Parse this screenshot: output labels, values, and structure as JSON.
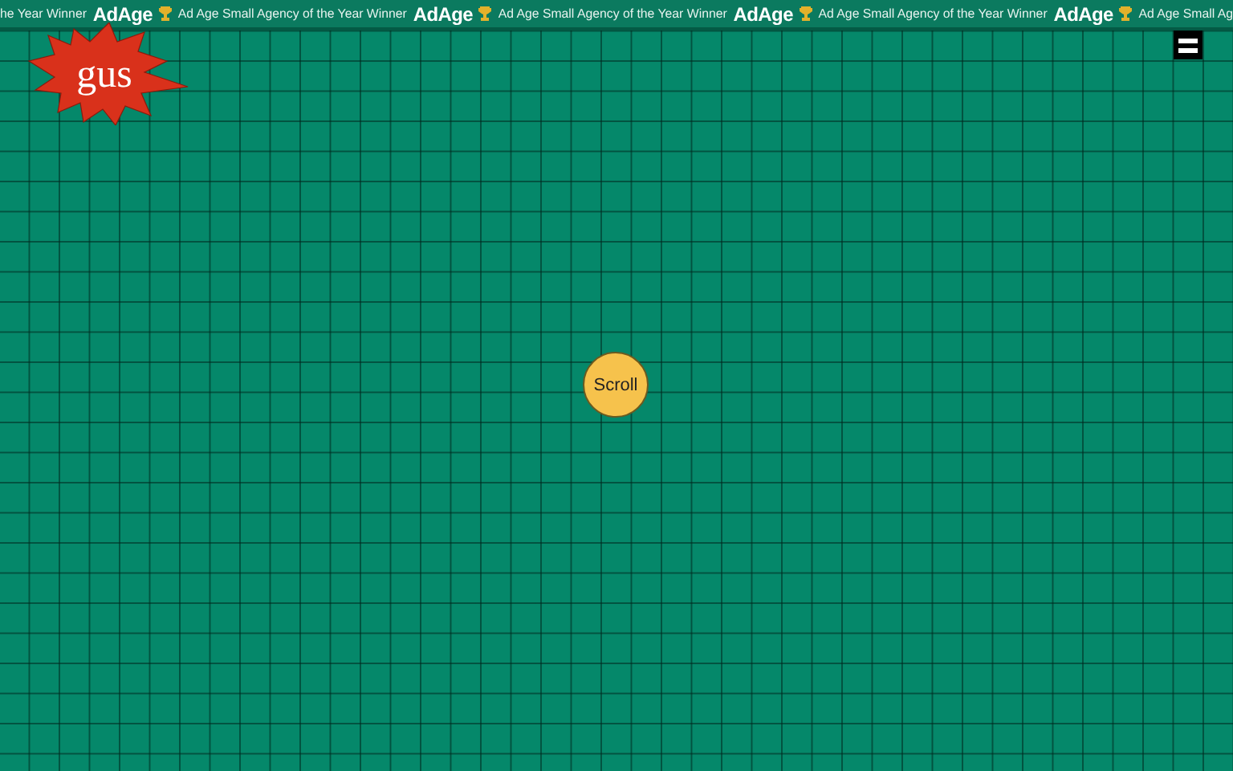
{
  "ticker": [
    {
      "kind": "award",
      "text": "he Year Winner"
    },
    {
      "kind": "logo",
      "text": "AdAge"
    },
    {
      "kind": "trophy"
    },
    {
      "kind": "award",
      "text": "Ad Age Small Agency of the Year Winner"
    },
    {
      "kind": "logo",
      "text": "AdAge"
    },
    {
      "kind": "trophy"
    },
    {
      "kind": "award",
      "text": "Ad Age Small Agency of the Year Winner"
    },
    {
      "kind": "logo",
      "text": "AdAge"
    },
    {
      "kind": "trophy"
    },
    {
      "kind": "award",
      "text": "Ad Age Small Agency of the Year Winner"
    },
    {
      "kind": "logo",
      "text": "AdAge"
    },
    {
      "kind": "trophy"
    },
    {
      "kind": "award",
      "text": "Ad Age Small Ag"
    }
  ],
  "logo": {
    "text": "gus"
  },
  "scroll_button": {
    "label": "Scroll"
  }
}
